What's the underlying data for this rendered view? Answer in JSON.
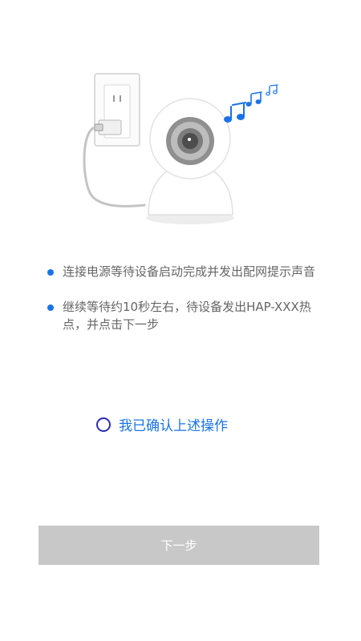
{
  "illustration": {
    "outlet_icon": "wall-outlet-icon",
    "camera_icon": "security-camera-icon",
    "sound_icon": "music-notes-icon"
  },
  "steps": [
    {
      "text": "连接电源等待设备启动完成并发出配网提示声音"
    },
    {
      "text": "继续等待约10秒左右，待设备发出HAP-XXX热点，并点击下一步"
    }
  ],
  "confirm": {
    "label": "我已确认上述操作",
    "checked": false
  },
  "next_button": {
    "label": "下一步",
    "enabled": false
  },
  "colors": {
    "accent": "#1a73e8",
    "radio_border": "#2b2fb3",
    "button_disabled": "#c8c8c8",
    "text_secondary": "#666666"
  }
}
